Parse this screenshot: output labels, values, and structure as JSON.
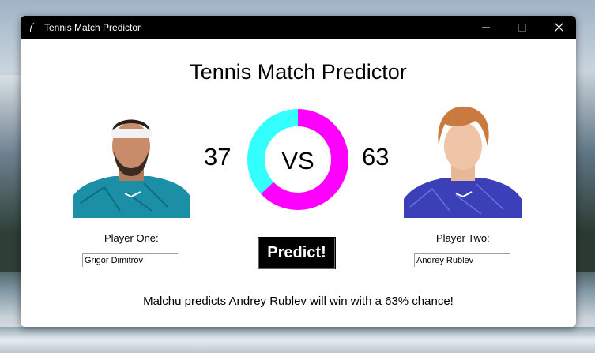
{
  "window": {
    "title": "Tennis Match Predictor"
  },
  "heading": "Tennis Match Predictor",
  "players": {
    "one": {
      "label": "Player One:",
      "name": "Grigor Dimitrov",
      "percent": "37"
    },
    "two": {
      "label": "Player Two:",
      "name": "Andrey Rublev",
      "percent": "63"
    }
  },
  "donut": {
    "center_text": "VS",
    "player_one_share": 37,
    "player_two_share": 63,
    "player_one_color": "#33ffff",
    "player_two_color": "#ff00ff"
  },
  "predict_button": "Predict!",
  "result_text": "Malchu predicts Andrey Rublev will win with a 63% chance!"
}
